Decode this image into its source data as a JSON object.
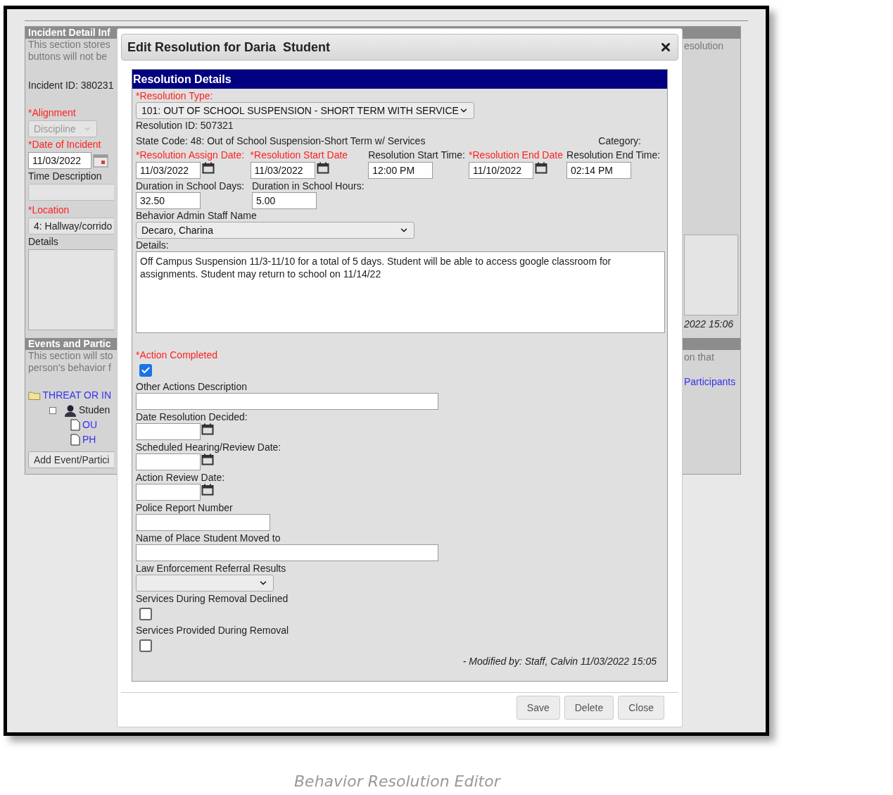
{
  "incident_panel": {
    "header": "Incident Detail Inf",
    "description": [
      "This section stores",
      "buttons will not be"
    ],
    "incident_id": "Incident ID: 380231",
    "alignment": {
      "label": "*Alignment",
      "required": true,
      "value": "Discipline"
    },
    "date_of_incident": {
      "label": "*Date of Incident",
      "required": true,
      "value": "11/03/2022"
    },
    "time_description": {
      "label": "Time Description",
      "required": false
    },
    "location": {
      "label": "*Location",
      "required": true,
      "value": "4: Hallway/corrido"
    },
    "details": {
      "label": "Details",
      "required": false
    },
    "right_text": "esolution",
    "timestamp": "2022 15:06"
  },
  "events_panel": {
    "header": "Events and Partic",
    "description": [
      "This section will sto",
      "person's behavior f"
    ],
    "right_text": "on that",
    "right_link": "Participants",
    "tree": [
      {
        "label": "THREAT OR IN",
        "kind": "folder",
        "children": [
          {
            "label": "Studen",
            "kind": "person",
            "children": [
              {
                "label": "OU",
                "kind": "document"
              },
              {
                "label": "PH",
                "kind": "document"
              }
            ]
          }
        ]
      }
    ],
    "add_button": "Add Event/Partici"
  },
  "dialog": {
    "title": "Edit Resolution for Daria  Student",
    "section_title": "Resolution Details",
    "resolution_type": {
      "label": "*Resolution Type:",
      "required": true,
      "value": "101: OUT OF SCHOOL SUSPENSION - SHORT TERM WITH SERVICE"
    },
    "resolution_id": "Resolution ID: 507321",
    "state_code": "State Code: 48: Out of School Suspension-Short Term w/ Services",
    "category": "Category:",
    "date_fields": [
      {
        "label": "*Resolution Assign Date:",
        "required": true,
        "kind": "date",
        "value": "11/03/2022"
      },
      {
        "label": "*Resolution Start Date",
        "required": true,
        "kind": "date",
        "value": "11/03/2022"
      },
      {
        "label": "Resolution Start Time:",
        "required": false,
        "kind": "time",
        "value": "12:00 PM"
      },
      {
        "label": "*Resolution End Date",
        "required": true,
        "kind": "date",
        "value": "11/10/2022"
      },
      {
        "label": "Resolution End Time:",
        "required": false,
        "kind": "time",
        "value": "02:14 PM"
      }
    ],
    "durations": [
      {
        "label": "Duration in School Days:",
        "value": "32.50"
      },
      {
        "label": "Duration in School Hours:",
        "value": "5.00"
      }
    ],
    "staff": {
      "label": "Behavior Admin Staff Name",
      "value": "Decaro, Charina"
    },
    "details": {
      "label": "Details:",
      "value": "Off Campus Suspension 11/3-11/10 for a total of 5 days.  Student will be able to access google classroom for assignments.  Student may return to school on 11/14/22"
    },
    "lower_fields": [
      {
        "kind": "checkbox",
        "label": "*Action Completed",
        "required": true,
        "checked": true
      },
      {
        "kind": "text",
        "label": "Other Actions Description",
        "required": false
      },
      {
        "kind": "date",
        "label": "Date Resolution Decided:",
        "required": false
      },
      {
        "kind": "date",
        "label": "Scheduled Hearing/Review Date:",
        "required": false
      },
      {
        "kind": "date",
        "label": "Action Review Date:",
        "required": false
      },
      {
        "kind": "short_text",
        "label": "Police Report Number",
        "required": false
      },
      {
        "kind": "text",
        "label": "Name of Place Student Moved to",
        "required": false
      },
      {
        "kind": "select",
        "label": "Law Enforcement Referral Results",
        "required": false
      },
      {
        "kind": "checkbox",
        "label": "Services During Removal Declined",
        "required": false,
        "checked": false
      },
      {
        "kind": "checkbox",
        "label": "Services Provided During Removal",
        "required": false,
        "checked": false
      }
    ],
    "modified": "- Modified by: Staff, Calvin 11/03/2022 15:05",
    "buttons": [
      "Save",
      "Delete",
      "Close"
    ]
  },
  "caption": "Behavior Resolution Editor"
}
